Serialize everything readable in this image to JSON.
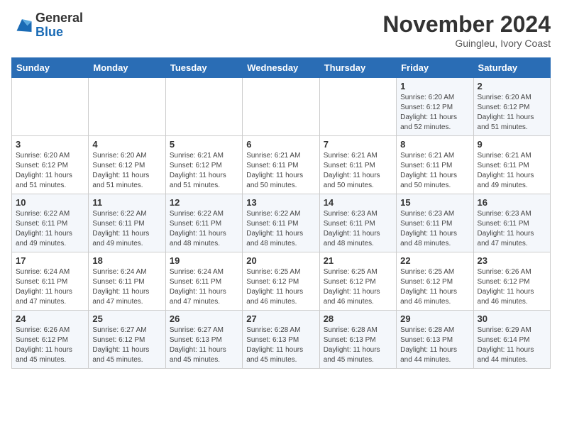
{
  "header": {
    "logo_general": "General",
    "logo_blue": "Blue",
    "month_title": "November 2024",
    "location": "Guingleu, Ivory Coast"
  },
  "weekdays": [
    "Sunday",
    "Monday",
    "Tuesday",
    "Wednesday",
    "Thursday",
    "Friday",
    "Saturday"
  ],
  "weeks": [
    [
      {
        "day": "",
        "info": ""
      },
      {
        "day": "",
        "info": ""
      },
      {
        "day": "",
        "info": ""
      },
      {
        "day": "",
        "info": ""
      },
      {
        "day": "",
        "info": ""
      },
      {
        "day": "1",
        "info": "Sunrise: 6:20 AM\nSunset: 6:12 PM\nDaylight: 11 hours\nand 52 minutes."
      },
      {
        "day": "2",
        "info": "Sunrise: 6:20 AM\nSunset: 6:12 PM\nDaylight: 11 hours\nand 51 minutes."
      }
    ],
    [
      {
        "day": "3",
        "info": "Sunrise: 6:20 AM\nSunset: 6:12 PM\nDaylight: 11 hours\nand 51 minutes."
      },
      {
        "day": "4",
        "info": "Sunrise: 6:20 AM\nSunset: 6:12 PM\nDaylight: 11 hours\nand 51 minutes."
      },
      {
        "day": "5",
        "info": "Sunrise: 6:21 AM\nSunset: 6:12 PM\nDaylight: 11 hours\nand 51 minutes."
      },
      {
        "day": "6",
        "info": "Sunrise: 6:21 AM\nSunset: 6:11 PM\nDaylight: 11 hours\nand 50 minutes."
      },
      {
        "day": "7",
        "info": "Sunrise: 6:21 AM\nSunset: 6:11 PM\nDaylight: 11 hours\nand 50 minutes."
      },
      {
        "day": "8",
        "info": "Sunrise: 6:21 AM\nSunset: 6:11 PM\nDaylight: 11 hours\nand 50 minutes."
      },
      {
        "day": "9",
        "info": "Sunrise: 6:21 AM\nSunset: 6:11 PM\nDaylight: 11 hours\nand 49 minutes."
      }
    ],
    [
      {
        "day": "10",
        "info": "Sunrise: 6:22 AM\nSunset: 6:11 PM\nDaylight: 11 hours\nand 49 minutes."
      },
      {
        "day": "11",
        "info": "Sunrise: 6:22 AM\nSunset: 6:11 PM\nDaylight: 11 hours\nand 49 minutes."
      },
      {
        "day": "12",
        "info": "Sunrise: 6:22 AM\nSunset: 6:11 PM\nDaylight: 11 hours\nand 48 minutes."
      },
      {
        "day": "13",
        "info": "Sunrise: 6:22 AM\nSunset: 6:11 PM\nDaylight: 11 hours\nand 48 minutes."
      },
      {
        "day": "14",
        "info": "Sunrise: 6:23 AM\nSunset: 6:11 PM\nDaylight: 11 hours\nand 48 minutes."
      },
      {
        "day": "15",
        "info": "Sunrise: 6:23 AM\nSunset: 6:11 PM\nDaylight: 11 hours\nand 48 minutes."
      },
      {
        "day": "16",
        "info": "Sunrise: 6:23 AM\nSunset: 6:11 PM\nDaylight: 11 hours\nand 47 minutes."
      }
    ],
    [
      {
        "day": "17",
        "info": "Sunrise: 6:24 AM\nSunset: 6:11 PM\nDaylight: 11 hours\nand 47 minutes."
      },
      {
        "day": "18",
        "info": "Sunrise: 6:24 AM\nSunset: 6:11 PM\nDaylight: 11 hours\nand 47 minutes."
      },
      {
        "day": "19",
        "info": "Sunrise: 6:24 AM\nSunset: 6:11 PM\nDaylight: 11 hours\nand 47 minutes."
      },
      {
        "day": "20",
        "info": "Sunrise: 6:25 AM\nSunset: 6:12 PM\nDaylight: 11 hours\nand 46 minutes."
      },
      {
        "day": "21",
        "info": "Sunrise: 6:25 AM\nSunset: 6:12 PM\nDaylight: 11 hours\nand 46 minutes."
      },
      {
        "day": "22",
        "info": "Sunrise: 6:25 AM\nSunset: 6:12 PM\nDaylight: 11 hours\nand 46 minutes."
      },
      {
        "day": "23",
        "info": "Sunrise: 6:26 AM\nSunset: 6:12 PM\nDaylight: 11 hours\nand 46 minutes."
      }
    ],
    [
      {
        "day": "24",
        "info": "Sunrise: 6:26 AM\nSunset: 6:12 PM\nDaylight: 11 hours\nand 45 minutes."
      },
      {
        "day": "25",
        "info": "Sunrise: 6:27 AM\nSunset: 6:12 PM\nDaylight: 11 hours\nand 45 minutes."
      },
      {
        "day": "26",
        "info": "Sunrise: 6:27 AM\nSunset: 6:13 PM\nDaylight: 11 hours\nand 45 minutes."
      },
      {
        "day": "27",
        "info": "Sunrise: 6:28 AM\nSunset: 6:13 PM\nDaylight: 11 hours\nand 45 minutes."
      },
      {
        "day": "28",
        "info": "Sunrise: 6:28 AM\nSunset: 6:13 PM\nDaylight: 11 hours\nand 45 minutes."
      },
      {
        "day": "29",
        "info": "Sunrise: 6:28 AM\nSunset: 6:13 PM\nDaylight: 11 hours\nand 44 minutes."
      },
      {
        "day": "30",
        "info": "Sunrise: 6:29 AM\nSunset: 6:14 PM\nDaylight: 11 hours\nand 44 minutes."
      }
    ]
  ]
}
